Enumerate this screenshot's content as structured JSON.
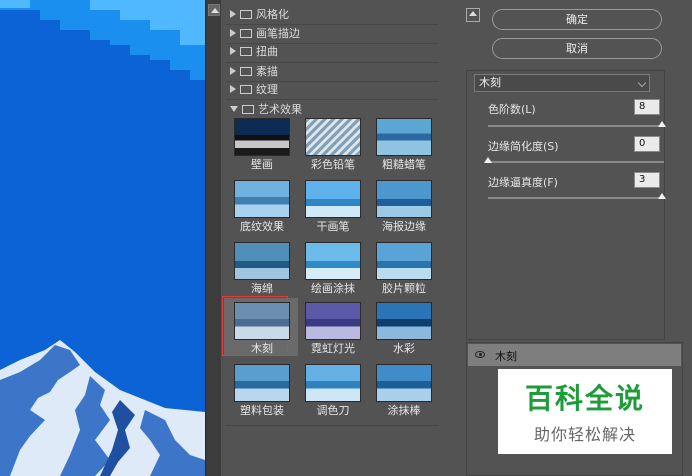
{
  "gallery": {
    "folders": [
      "风格化",
      "画笔描边",
      "扭曲",
      "素描",
      "纹理"
    ],
    "open_folder": "艺术效果",
    "filters": [
      "壁画",
      "彩色铅笔",
      "粗糙蜡笔",
      "底纹效果",
      "干画笔",
      "海报边缘",
      "海绵",
      "绘画涂抹",
      "胶片颗粒",
      "木刻",
      "霓虹灯光",
      "水彩",
      "塑料包装",
      "调色刀",
      "涂抹棒"
    ],
    "selected": "木刻"
  },
  "buttons": {
    "ok": "确定",
    "cancel": "取消"
  },
  "settings": {
    "filter_select": "木刻",
    "params": [
      {
        "label": "色阶数(L)",
        "value": "8",
        "fraction": 1.0
      },
      {
        "label": "边缘简化度(S)",
        "value": "0",
        "fraction": 0.0
      },
      {
        "label": "边缘逼真度(F)",
        "value": "3",
        "fraction": 1.0
      }
    ]
  },
  "layers": {
    "item": "木刻"
  },
  "watermark": {
    "line1": "百科全说",
    "line2": "助你轻松解决"
  },
  "colors": {
    "selection_outline": "#e23b3b",
    "watermark_green": "#1e9c3a"
  }
}
